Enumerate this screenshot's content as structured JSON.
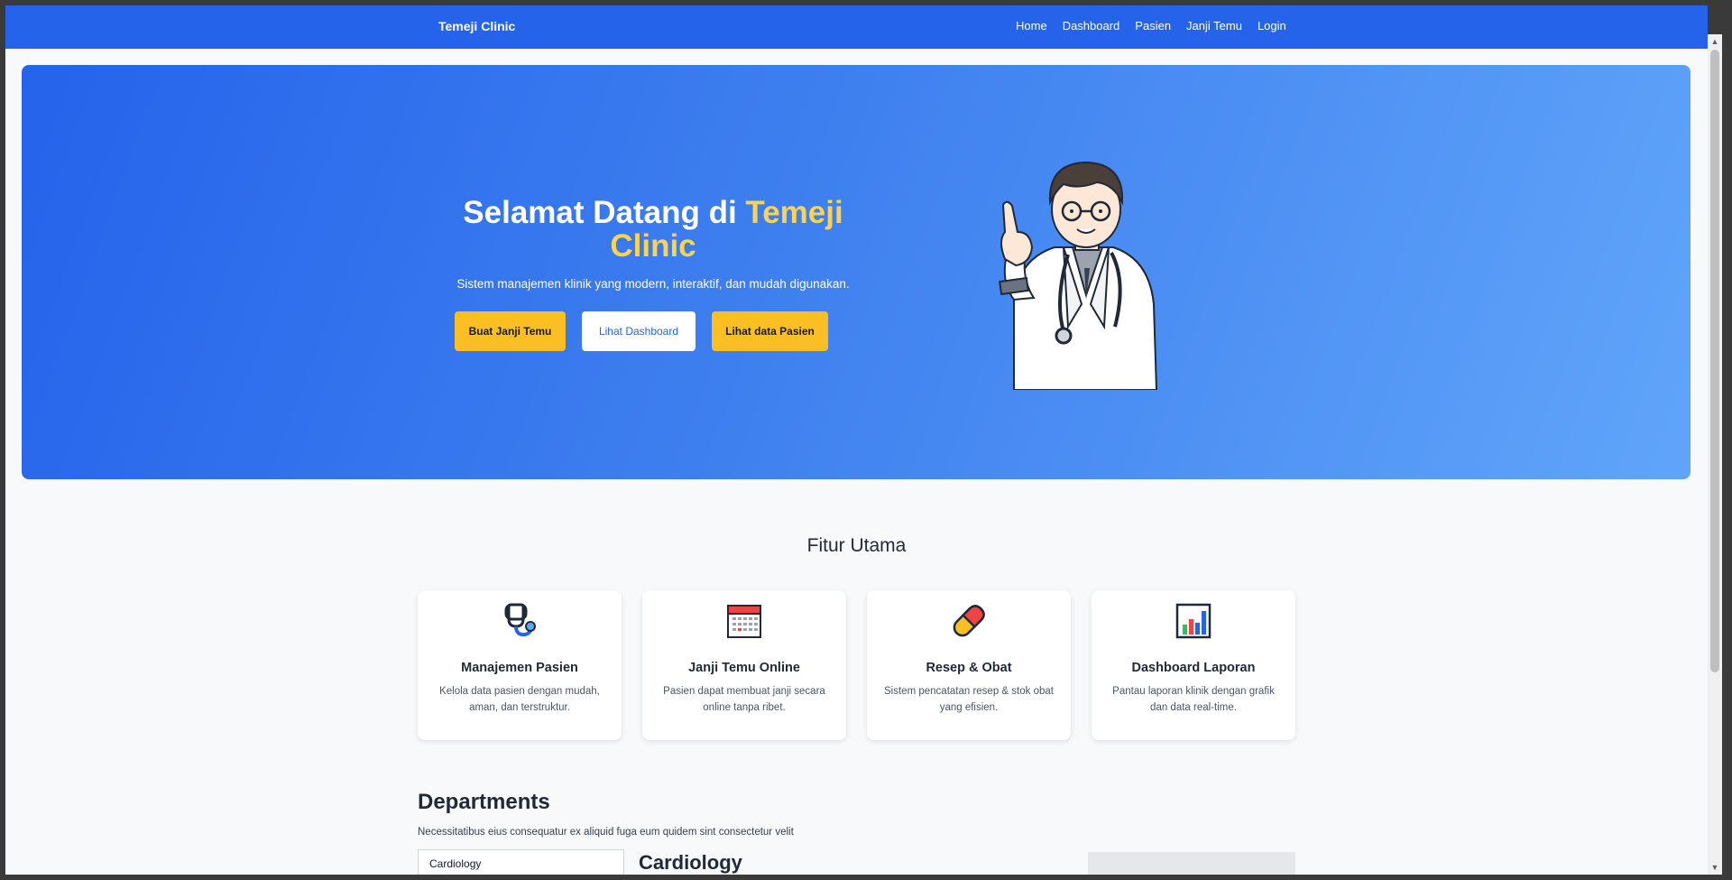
{
  "navbar": {
    "brand": "Temeji Clinic",
    "links": [
      "Home",
      "Dashboard",
      "Pasien",
      "Janji Temu",
      "Login"
    ]
  },
  "hero": {
    "title_prefix": "Selamat Datang di ",
    "title_accent": "Temeji Clinic",
    "subtitle": "Sistem manajemen klinik yang modern, interaktif, dan mudah digunakan.",
    "buttons": {
      "appointment": "Buat Janji Temu",
      "dashboard": "Lihat Dashboard",
      "patients": "Lihat data Pasien"
    }
  },
  "features": {
    "title": "Fitur Utama",
    "cards": [
      {
        "icon": "stethoscope-icon",
        "title": "Manajemen Pasien",
        "desc": "Kelola data pasien dengan mudah, aman, dan terstruktur."
      },
      {
        "icon": "calendar-icon",
        "title": "Janji Temu Online",
        "desc": "Pasien dapat membuat janji secara online tanpa ribet."
      },
      {
        "icon": "pill-icon",
        "title": "Resep & Obat",
        "desc": "Sistem pencatatan resep & stok obat yang efisien."
      },
      {
        "icon": "bar-chart-icon",
        "title": "Dashboard Laporan",
        "desc": "Pantau laporan klinik dengan grafik dan data real-time."
      }
    ]
  },
  "departments": {
    "title": "Departments",
    "description": "Necessitatibus eius consequatur ex aliquid fuga eum quidem sint consectetur velit",
    "tabs": [
      "Cardiology"
    ],
    "active_heading": "Cardiology"
  },
  "colors": {
    "primary": "#2563eb",
    "accent": "#fbbf24",
    "highlight": "#fcd34d"
  }
}
